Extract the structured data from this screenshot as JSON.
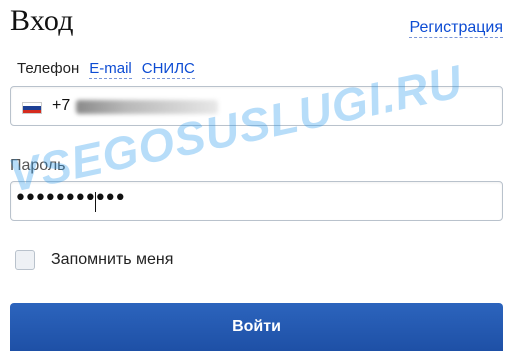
{
  "header": {
    "title": "Вход",
    "register_link": "Регистрация"
  },
  "login_tabs": [
    {
      "label": "Телефон",
      "active": true
    },
    {
      "label": "E-mail",
      "active": false
    },
    {
      "label": "СНИЛС",
      "active": false
    }
  ],
  "phone_field": {
    "flag": "russia-flag-icon",
    "prefix": "+7"
  },
  "password_field": {
    "label": "Пароль",
    "value_masked": "•••••••••••"
  },
  "remember_me": {
    "label": "Запомнить меня",
    "checked": false
  },
  "submit": {
    "label": "Войти"
  },
  "watermark": "VSEGOSUSLUGI.RU",
  "colors": {
    "link": "#0d4cd3",
    "button": "#2c64bd",
    "border": "#b9c2cc"
  }
}
